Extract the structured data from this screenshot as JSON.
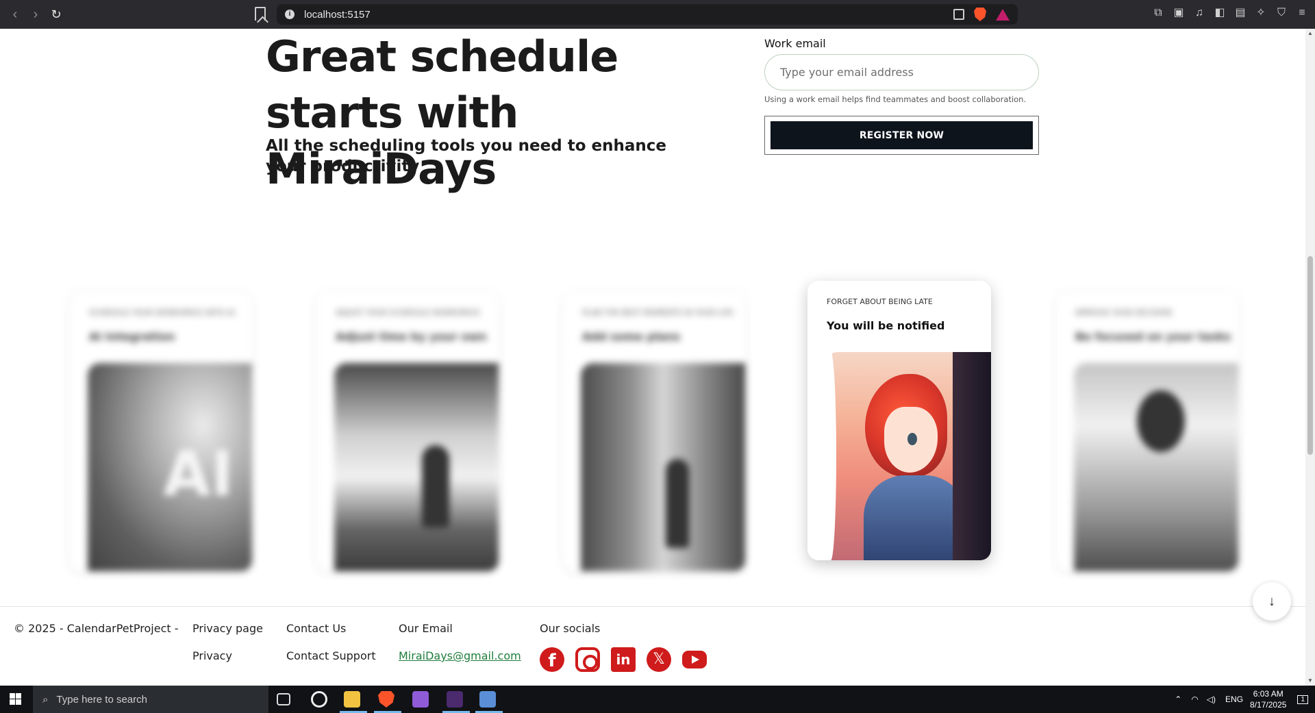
{
  "browser": {
    "url": "localhost:5157",
    "colors": {
      "chrome": "#2b2b2f",
      "brave": "#fb542b"
    }
  },
  "hero": {
    "title": "Great schedule starts with MiraiDays",
    "subtitle": "All the scheduling tools you need to enhance your productivity"
  },
  "signup": {
    "email_label": "Work email",
    "email_placeholder": "Type your email address",
    "email_value": "",
    "hint": "Using a work email helps find teammates and boost collaboration.",
    "register_label": "REGISTER NOW"
  },
  "cards": [
    {
      "eyebrow": "Schedule your workspace with AI",
      "title": "AI Integration",
      "image": "ai-illustration",
      "state": "blurred"
    },
    {
      "eyebrow": "Adjust your schedule workspace",
      "title": "Adjust time by your own",
      "image": "city-window-illustration",
      "state": "blurred"
    },
    {
      "eyebrow": "Plan the best moments in your life",
      "title": "Add some plans",
      "image": "forest-girl-illustration",
      "state": "blurred"
    },
    {
      "eyebrow": "Forget about being late",
      "title": "You will be notified",
      "image": "anime-girl-illustration",
      "state": "active"
    },
    {
      "eyebrow": "Improve your decision",
      "title": "Be focused on your tasks",
      "image": "girl-working-illustration",
      "state": "blurred"
    }
  ],
  "scroll_button": {
    "glyph": "↓"
  },
  "footer": {
    "copyright": "© 2025 - CalendarPetProject -",
    "privacy_page": "Privacy page",
    "privacy": "Privacy",
    "contact_us": "Contact Us",
    "contact_support": "Contact Support",
    "our_email": "Our Email",
    "email": "MiraiDays@gmail.com",
    "our_socials": "Our socials",
    "socials": [
      "facebook-icon",
      "instagram-icon",
      "linkedin-icon",
      "x-icon",
      "youtube-icon"
    ],
    "social_color": "#cf1b1b"
  },
  "taskbar": {
    "search_placeholder": "Type here to search",
    "language": "ENG",
    "time": "6:03 AM",
    "date": "8/17/2025",
    "notifications": "1"
  }
}
